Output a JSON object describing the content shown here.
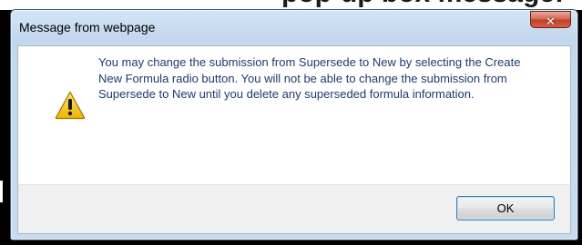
{
  "background_heading": "pop-up box message:",
  "dialog": {
    "title": "Message from webpage",
    "close_icon": "close-icon",
    "message": "You may change the submission from Supersede to New by selecting the Create New Formula radio button. You will not be able to change the submission from Supersede to New until you delete any superseded formula information.",
    "icon": "warning-icon",
    "ok_label": "OK"
  },
  "colors": {
    "title_bar": "#c3d7ee",
    "close_button": "#c1412a",
    "message_text": "#1e3a6e",
    "warning_yellow": "#f5c400",
    "ok_border": "#3c7fb1"
  }
}
